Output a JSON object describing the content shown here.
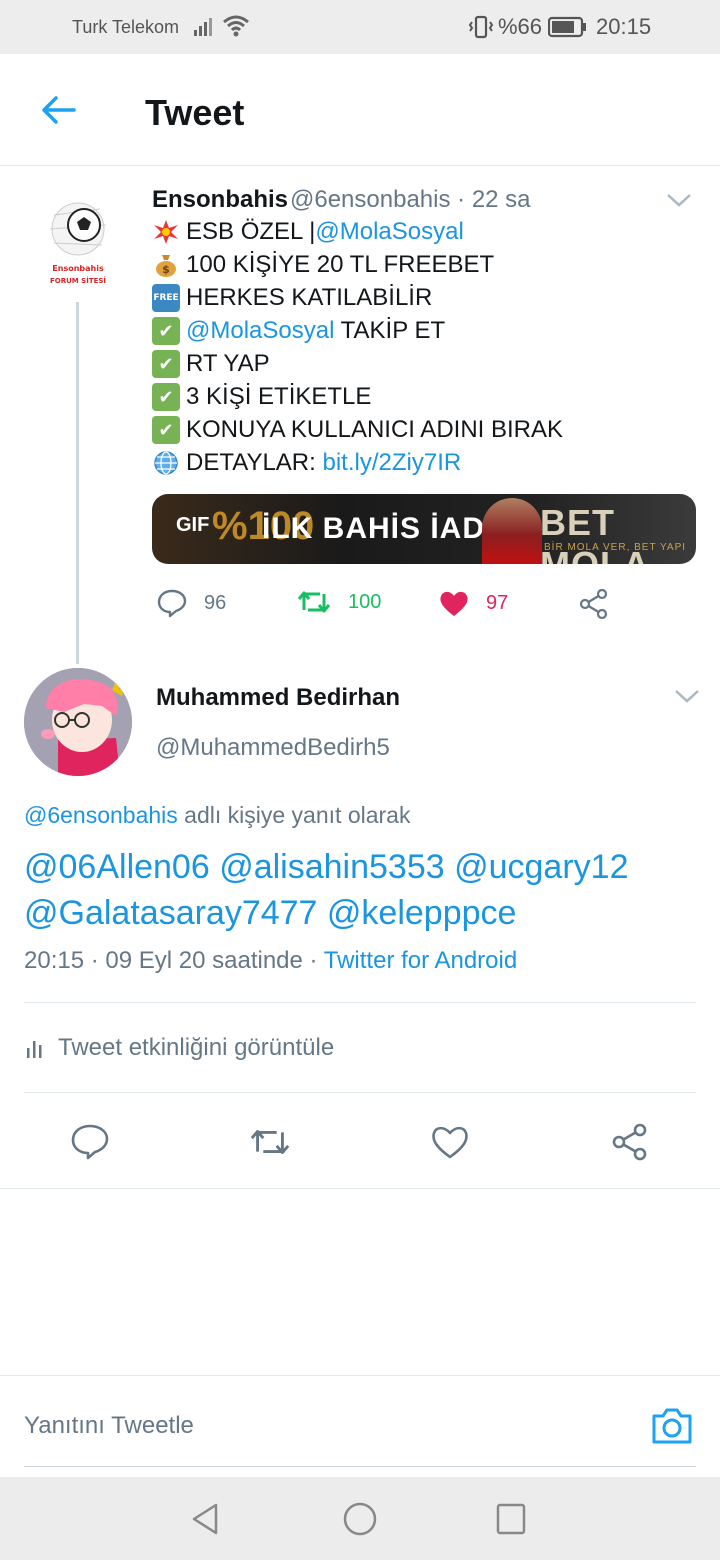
{
  "status_bar": {
    "carrier": "Turk Telekom",
    "battery": "%66",
    "time": "20:15",
    "icons": [
      "signal-icon",
      "wifi-icon",
      "vibrate-icon",
      "battery-icon"
    ]
  },
  "header": {
    "title": "Tweet",
    "back_icon": "arrow-left-icon"
  },
  "parent_tweet": {
    "avatar_text": [
      "Ensonbahis",
      "FORUM SİTESİ"
    ],
    "name": "Ensonbahis",
    "handle": "@6ensonbahis",
    "time": "· 22 sa",
    "lines": [
      {
        "emoji": "💥",
        "text": "ESB ÖZEL | ",
        "link": "@MolaSosyal"
      },
      {
        "emoji": "💰",
        "text": "100 KİŞİYE 20 TL FREEBET"
      },
      {
        "emoji": "FREE",
        "text": "HERKES KATILABİLİR"
      },
      {
        "emoji": "✔",
        "link": "@MolaSosyal",
        "text": " TAKİP ET"
      },
      {
        "emoji": "✔",
        "text": "RT YAP"
      },
      {
        "emoji": "✔",
        "text": "3 KİŞİ ETİKETLE"
      },
      {
        "emoji": "✔",
        "text": "KONUYA KULLANICI ADINI BIRAK"
      },
      {
        "emoji": "🌐",
        "text": "DETAYLAR: ",
        "link": "bit.ly/2Ziy7IR"
      }
    ],
    "media": {
      "badge": "GIF",
      "pct": "%100",
      "text": "İLK BAHİS İADE",
      "brand": "BET MOLA",
      "tagline": "BİR MOLA VER, BET YAPI"
    },
    "stats": {
      "replies": "96",
      "retweets": "100",
      "likes": "97"
    },
    "colors": {
      "retweet": "#17bf63",
      "like": "#e0245e"
    }
  },
  "tweet": {
    "name": "Muhammed Bedirhan",
    "handle": "@MuhammedBedirh5",
    "reply_context": {
      "handle": "@6ensonbahis",
      "suffix": " adlı kişiye yanıt olarak"
    },
    "text": "@06Allen06 @alisahin5353 @ucgary12 @Galatasaray7477 @kelepppce",
    "meta": {
      "datetime": "20:15 · 09 Eyl 20 saatinde · ",
      "source": "Twitter for Android"
    },
    "activity_label": "Tweet etkinliğini görüntüle"
  },
  "reply_box": {
    "placeholder": "Yanıtını Tweetle"
  },
  "colors": {
    "accent": "#1da1f2",
    "link": "#1b95e0",
    "muted": "#657786"
  }
}
